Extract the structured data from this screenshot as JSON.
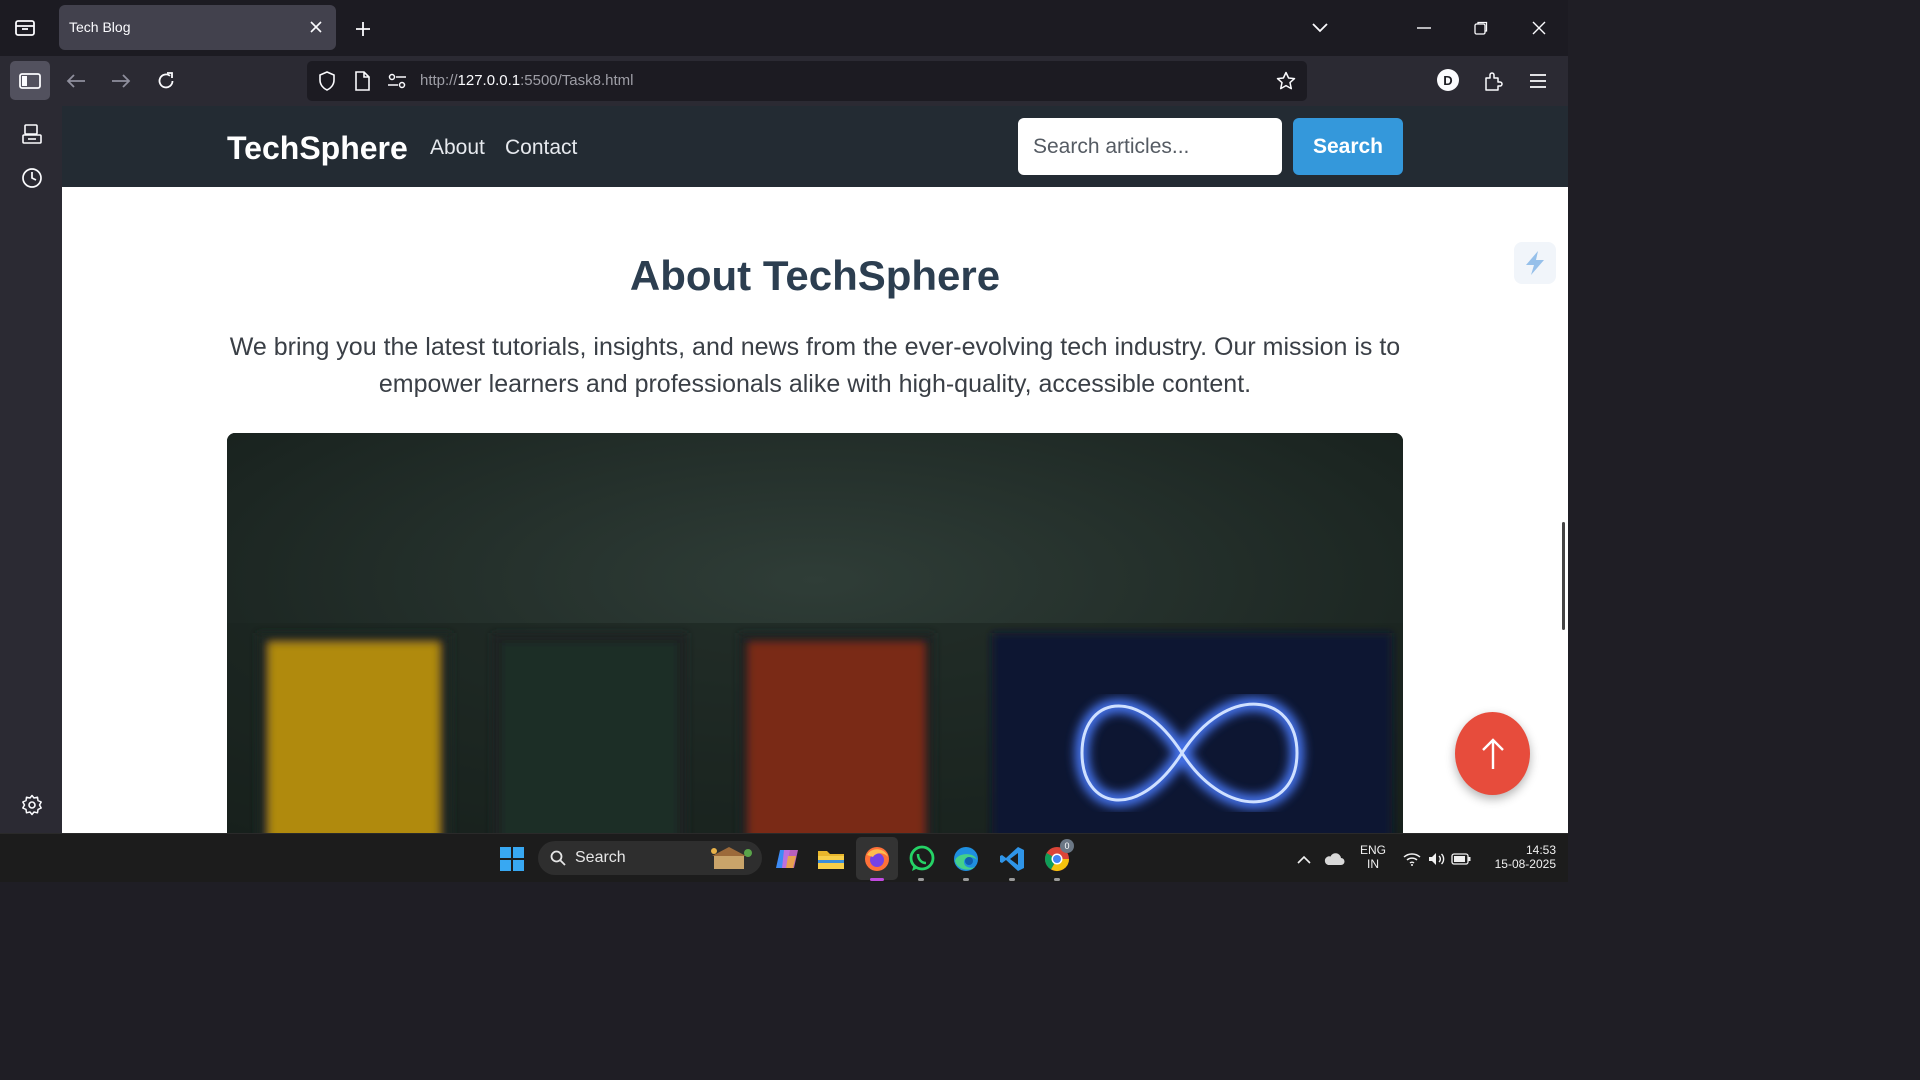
{
  "browser": {
    "tab_title": "Tech Blog",
    "url_scheme": "http://",
    "url_host": "127.0.0.1",
    "url_rest": ":5500/Task8.html",
    "profile_initial": "D"
  },
  "site": {
    "logo": "TechSphere",
    "nav": [
      "About",
      "Contact"
    ],
    "search_placeholder": "Search articles...",
    "search_button": "Search",
    "about_title": "About TechSphere",
    "about_text": "We bring you the latest tutorials, insights, and news from the ever-evolving tech industry. Our mission is to empower learners and professionals alike with high-quality, accessible content.",
    "accent_color": "#3498db",
    "scroll_top_color": "#e74c3c"
  },
  "taskbar": {
    "search_label": "Search",
    "lang_line1": "ENG",
    "lang_line2": "IN",
    "time": "14:53",
    "date": "15-08-2025",
    "chrome_badge": "0"
  }
}
